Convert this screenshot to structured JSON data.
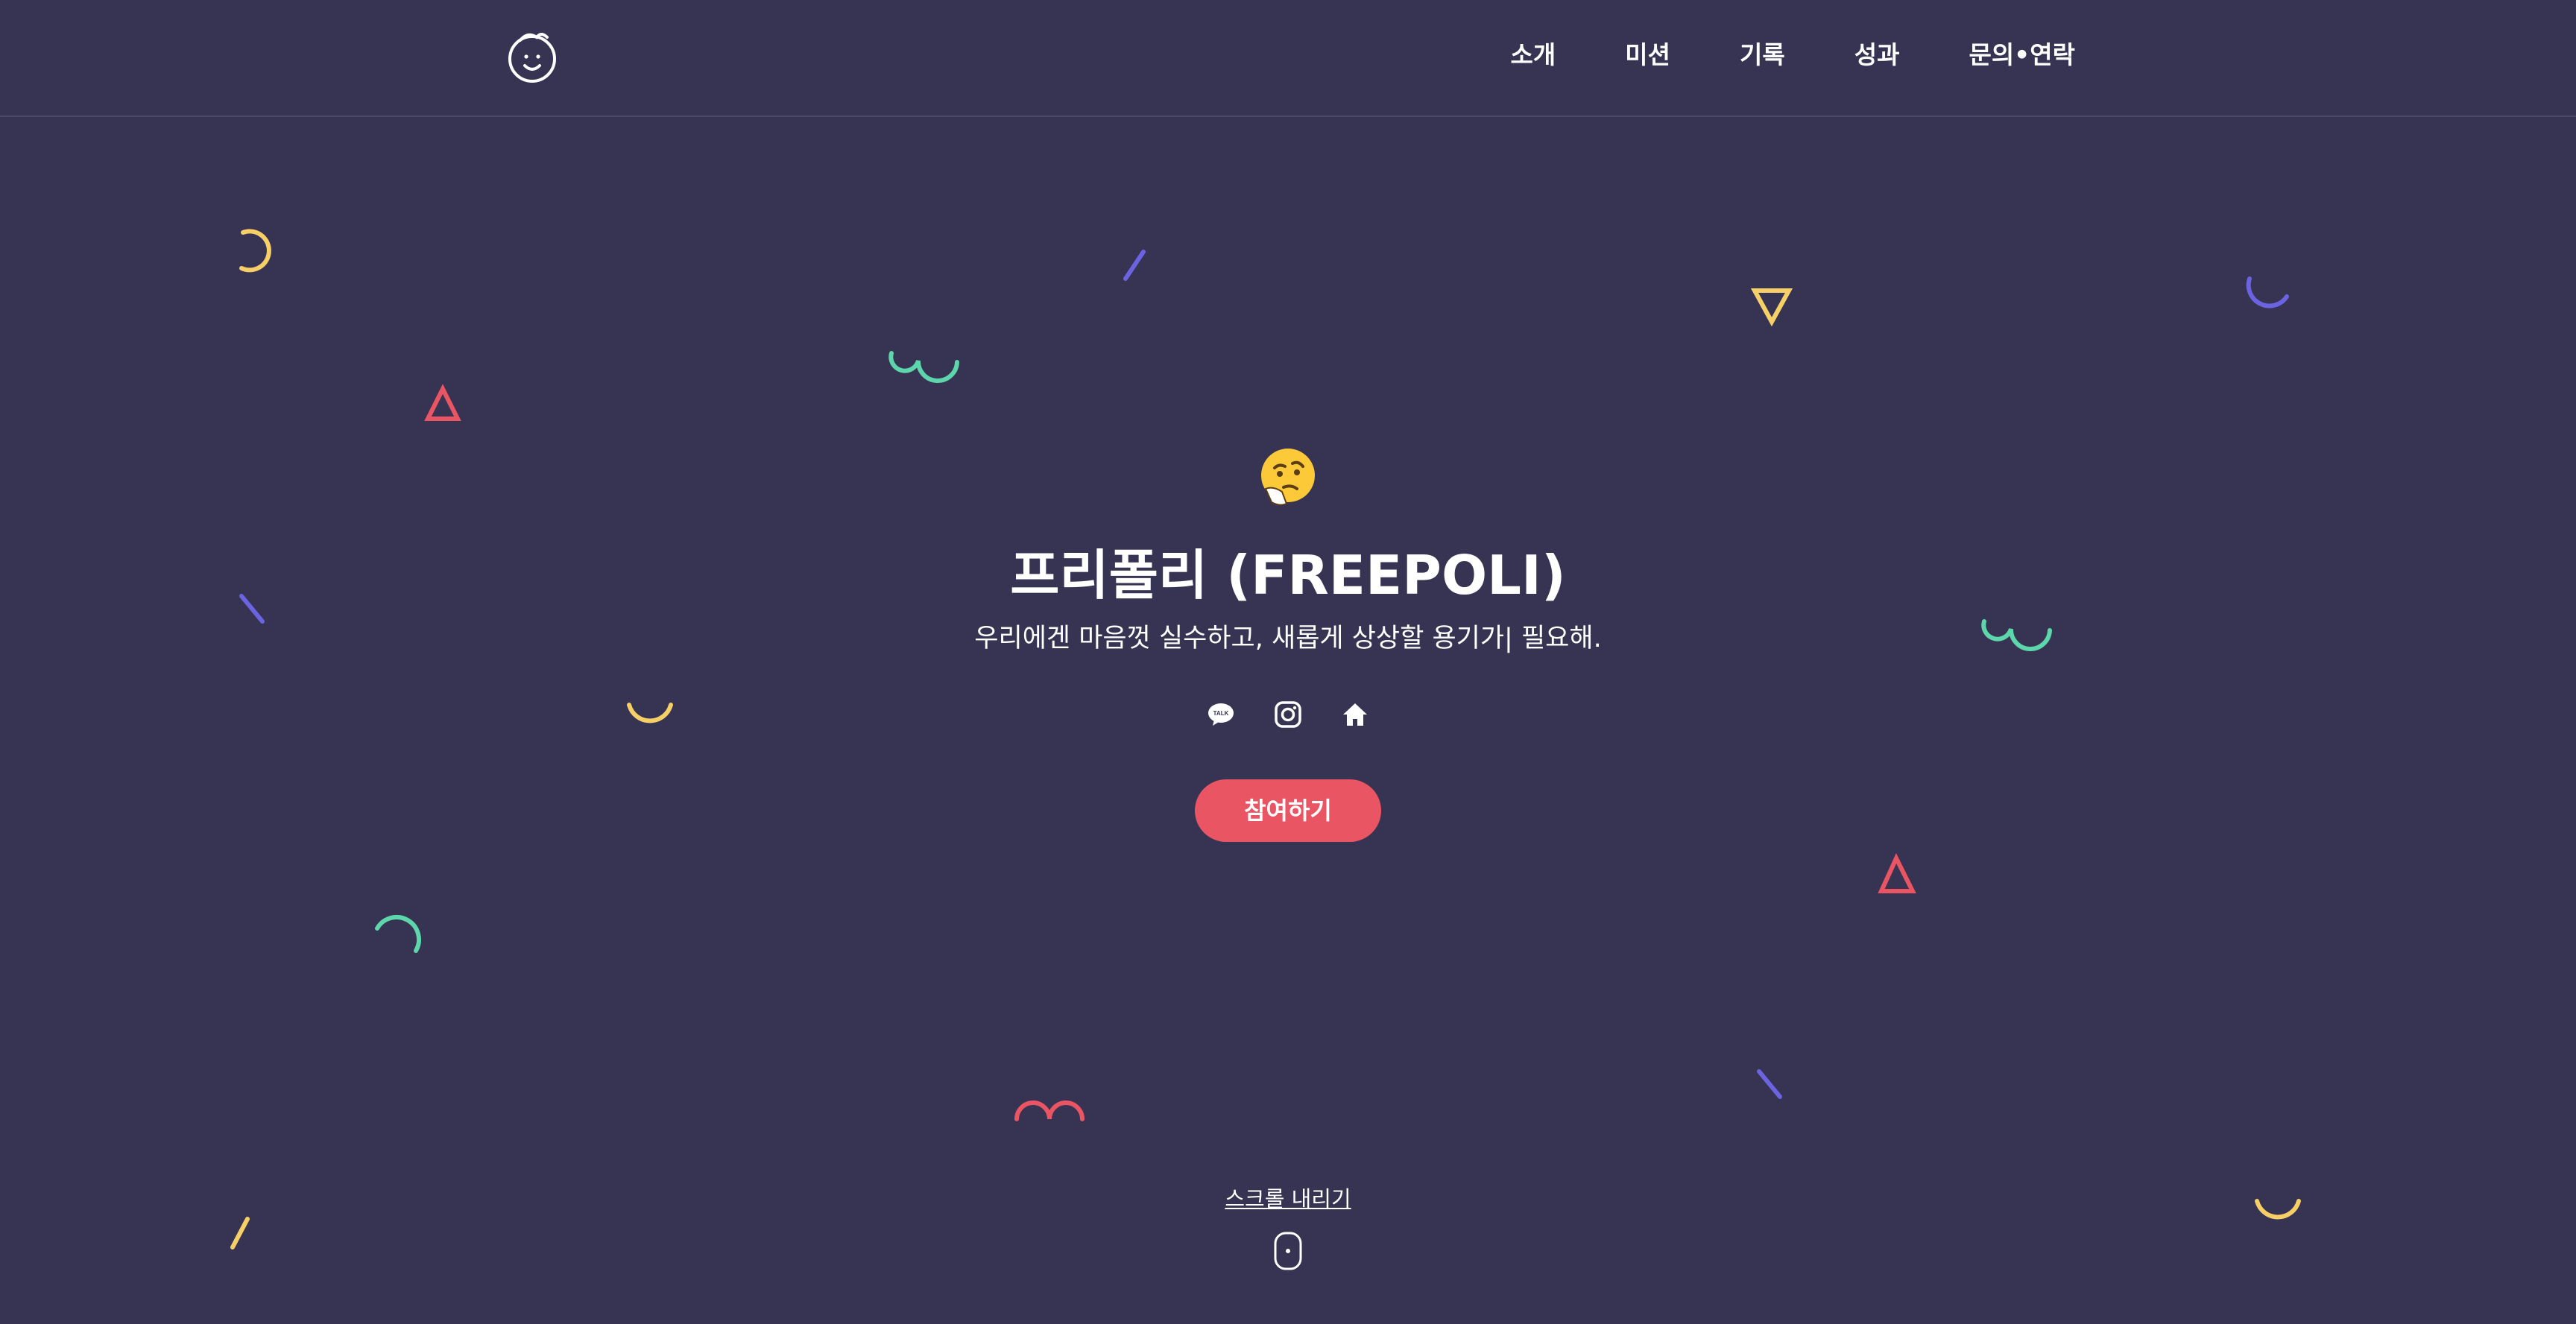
{
  "header": {
    "logo_icon": "smiley-face-logo-icon",
    "nav": [
      "소개",
      "미션",
      "기록",
      "성과",
      "문의•연락"
    ]
  },
  "hero": {
    "emoji_icon": "thinking-face-icon",
    "title": "프리폴리 (FREEPOLI)",
    "subtitle": "우리에겐 마음껏 실수하고, 새롭게 상상할 용기가| 필요해.",
    "social_icons": [
      "kakaotalk-icon",
      "instagram-icon",
      "home-icon"
    ],
    "cta_label": "참여하기"
  },
  "scroll": {
    "label": "스크롤 내리기",
    "icon": "mouse-scroll-icon"
  },
  "colors": {
    "background": "#363353",
    "accent": "#ea5564",
    "yellow": "#f7cf67",
    "green": "#5ed6ab",
    "purple": "#6b63e0",
    "red": "#ea5564"
  }
}
